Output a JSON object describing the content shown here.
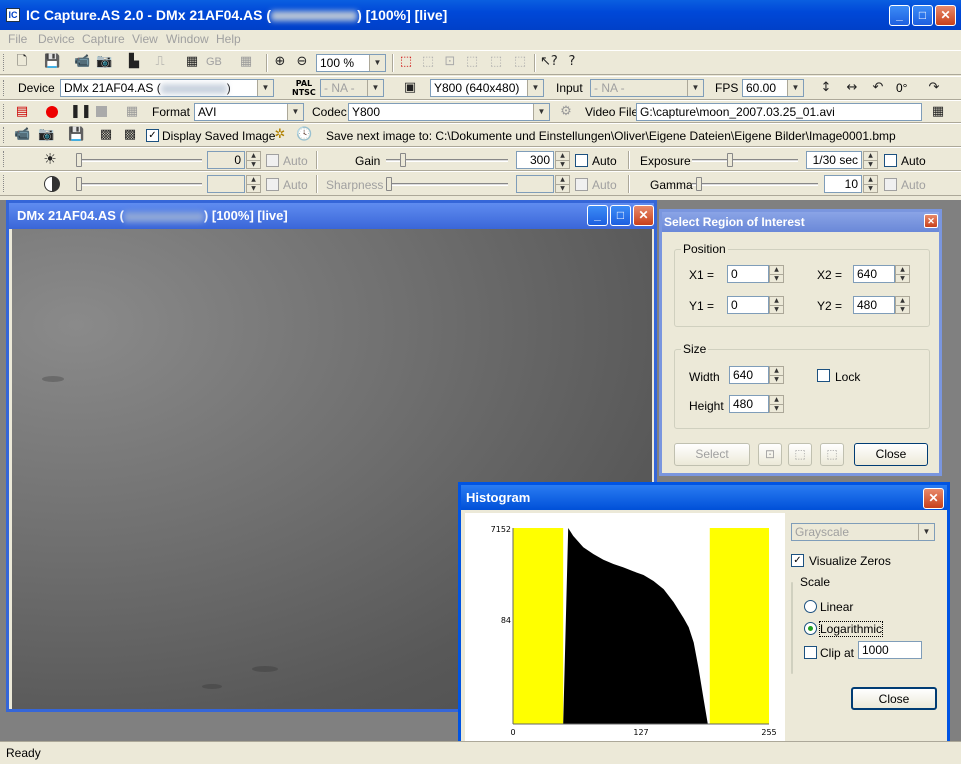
{
  "app": {
    "title_prefix": "IC Capture.AS 2.0 - DMx 21AF04.AS (",
    "title_suffix": ") [100%]  [live]",
    "icon": "IC"
  },
  "menu": [
    "File",
    "Device",
    "Capture",
    "View",
    "Window",
    "Help"
  ],
  "toolbar1": {
    "zoom": "100 %",
    "gb_label": "GB"
  },
  "device_bar": {
    "device_label": "Device",
    "device_prefix": "DMx 21AF04.AS (",
    "device_suffix": ")",
    "pal_top": "PAL",
    "pal_bottom": "NTSC",
    "video_norm": "- NA -",
    "format": "Y800 (640x480)",
    "input_label": "Input",
    "input": "- NA -",
    "fps_label": "FPS",
    "fps": "60.00",
    "rotation": "0°"
  },
  "capture_bar": {
    "format_label": "Format",
    "format": "AVI",
    "codec_label": "Codec",
    "codec": "Y800",
    "video_file_label": "Video File",
    "video_file": "G:\\capture\\moon_2007.03.25_01.avi"
  },
  "image_bar": {
    "display_saved": "Display Saved Image",
    "save_next": "Save next image to: C:\\Dokumente und Einstellungen\\Oliver\\Eigene Dateien\\Eigene Bilder\\Image0001.bmp"
  },
  "props1": {
    "brightness": {
      "value": "0",
      "auto": "Auto",
      "level": 0.0
    },
    "gain": {
      "label": "Gain",
      "value": "300",
      "auto": "Auto",
      "level": 0.12
    },
    "exposure": {
      "label": "Exposure",
      "value": "1/30 sec",
      "auto": "Auto",
      "level": 0.35
    }
  },
  "props2": {
    "contrast": {
      "value": "",
      "auto": "Auto",
      "level": 0.0
    },
    "sharpness": {
      "label": "Sharpness",
      "value": "",
      "auto": "Auto",
      "level": 0.0
    },
    "gamma": {
      "label": "Gamma",
      "value": "10",
      "auto": "Auto",
      "level": 0.03
    }
  },
  "live_window": {
    "title_prefix": "DMx 21AF04.AS (",
    "title_suffix": ") [100%]  [live]"
  },
  "roi": {
    "title": "Select Region of Interest",
    "position_label": "Position",
    "x1_label": "X1 =",
    "x1": "0",
    "x2_label": "X2 =",
    "x2": "640",
    "y1_label": "Y1 =",
    "y1": "0",
    "y2_label": "Y2 =",
    "y2": "480",
    "size_label": "Size",
    "width_label": "Width",
    "width": "640",
    "height_label": "Height",
    "height": "480",
    "lock_label": "Lock",
    "select_button": "Select",
    "close_button": "Close"
  },
  "histogram": {
    "title": "Histogram",
    "mode": "Grayscale",
    "visualize_zeros": "Visualize Zeros",
    "scale_label": "Scale",
    "linear": "Linear",
    "logarithmic": "Logarithmic",
    "clip_label": "Clip at",
    "clip_value": "1000",
    "close_button": "Close",
    "y_top": "7152",
    "y_mid": "84",
    "x_min": "0",
    "x_mid": "127",
    "x_max": "255",
    "zero_range_low": [
      0,
      50
    ],
    "zero_range_high": [
      196,
      255
    ],
    "colors": {
      "zero": "#ffff00",
      "bars": "#000000"
    }
  },
  "chart_data": {
    "type": "area",
    "x": [
      50,
      55,
      60,
      70,
      80,
      90,
      100,
      110,
      120,
      130,
      140,
      150,
      160,
      170,
      175,
      180,
      185,
      190,
      194,
      196
    ],
    "values": [
      0,
      7152,
      5000,
      3000,
      2200,
      1700,
      1400,
      1200,
      1000,
      850,
      650,
      450,
      250,
      120,
      80,
      40,
      12,
      3,
      1,
      0
    ],
    "xlim": [
      0,
      255
    ],
    "ylim": [
      1,
      7152
    ],
    "yscale": "log",
    "x_ticks": [
      "0",
      "127",
      "255"
    ],
    "y_ticks": [
      "84",
      "7152"
    ]
  },
  "status": "Ready"
}
